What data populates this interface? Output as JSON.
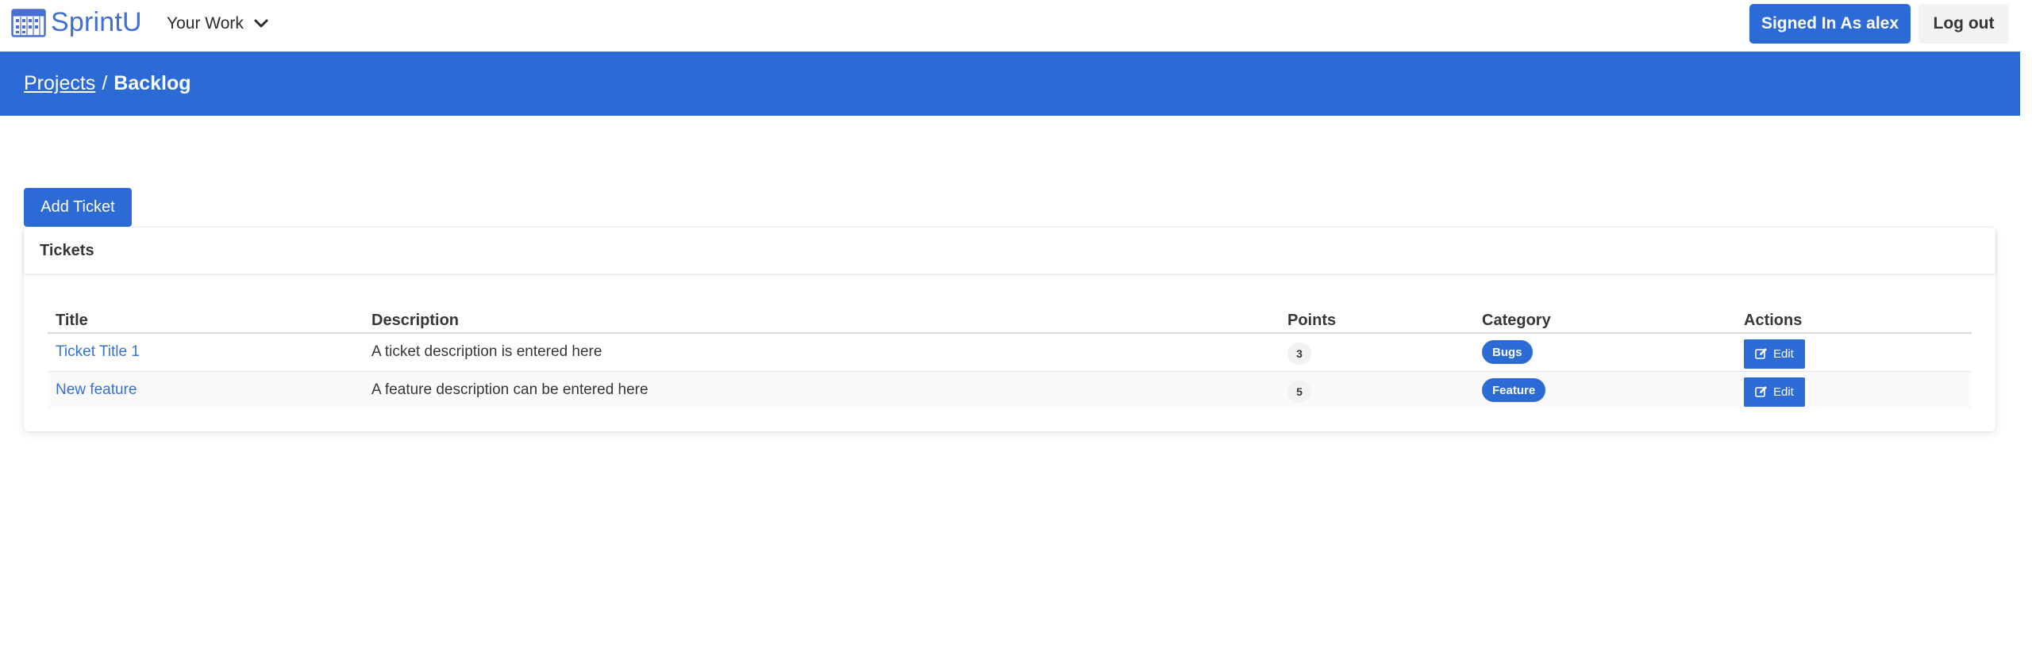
{
  "navbar": {
    "brand": "SprintU",
    "brand_icon": "calendar-grid-icon",
    "dropdown_label": "Your Work",
    "dropdown_icon": "chevron-down-icon",
    "signed_in_label": "Signed In As alex",
    "logout_label": "Log out"
  },
  "breadcrumb": {
    "parent": "Projects",
    "separator": "/",
    "current": "Backlog"
  },
  "add_ticket_label": "Add Ticket",
  "tickets_card": {
    "title": "Tickets",
    "columns": [
      "Title",
      "Description",
      "Points",
      "Category",
      "Actions"
    ],
    "rows": [
      {
        "title": "Ticket Title 1",
        "description": "A ticket description is entered here",
        "points": "3",
        "category": "Bugs",
        "action_label": "Edit",
        "action_icon": "edit-icon"
      },
      {
        "title": "New feature",
        "description": "A feature description can be entered here",
        "points": "5",
        "category": "Feature",
        "action_label": "Edit",
        "action_icon": "edit-icon"
      }
    ]
  },
  "colors": {
    "primary": "#2c6bd6",
    "brand_text": "#3f6fd6",
    "light_button": "#f2f2f2",
    "text": "#363636"
  }
}
